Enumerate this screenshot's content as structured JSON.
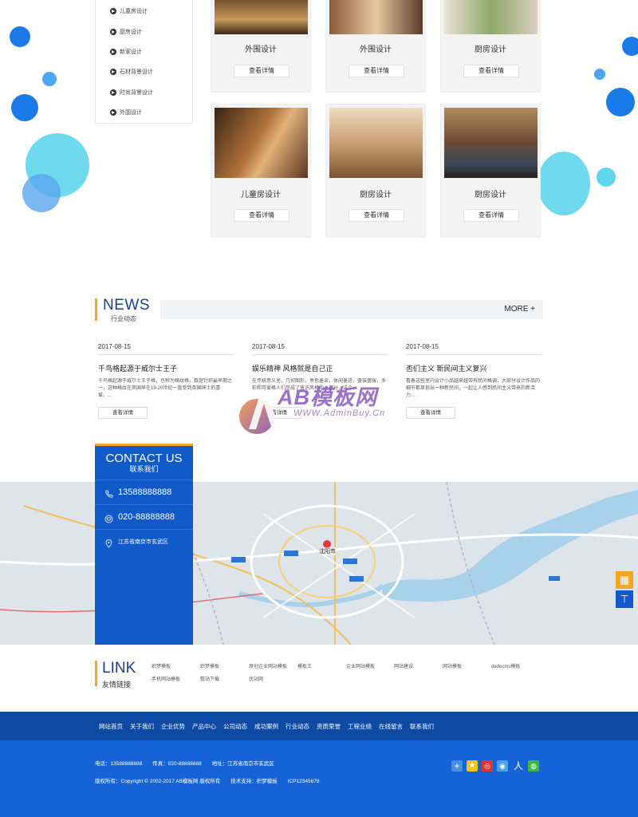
{
  "categories": [
    {
      "label": "儿童房设计"
    },
    {
      "label": "厨房设计"
    },
    {
      "label": "新家设计"
    },
    {
      "label": "石材背景设计"
    },
    {
      "label": "时尚背景设计"
    },
    {
      "label": "外围设计"
    }
  ],
  "products": [
    {
      "title": "外围设计",
      "button": "查看详情"
    },
    {
      "title": "外围设计",
      "button": "查看详情"
    },
    {
      "title": "厨房设计",
      "button": "查看详情"
    },
    {
      "title": "儿童房设计",
      "button": "查看详情"
    },
    {
      "title": "厨房设计",
      "button": "查看详情"
    },
    {
      "title": "厨房设计",
      "button": "查看详情"
    }
  ],
  "news": {
    "title": "NEWS",
    "subtitle": "行业动态",
    "more": "MORE +",
    "items": [
      {
        "date": "2017-08-15",
        "headline": "千鸟格起源于威尔士王子",
        "excerpt": "千鸟格起源于威尔士王子格，也称为格纹格，数是针织最早期之一，这种格纹在英国早在19-20世纪一直受到英国绅士的喜爱。...",
        "button": "查看详情"
      },
      {
        "date": "2017-08-15",
        "headline": "娱乐精神 风格就是自己正",
        "excerpt": "在传统意义里，几何图形，黑色墨染，休闲墨迹，盛装盛服，多彩和可爱格人们尽成了鉴识风格的一部分，这个…",
        "button": "查看详情"
      },
      {
        "date": "2017-08-15",
        "headline": "否们主义 新民间主义复兴",
        "excerpt": "看着这些室内设计小品越来越带有民间格调，大部分设计作品的细节都显现出一种新民间，一起让人感到民间主义带来的新活力…",
        "button": "查看详情"
      }
    ]
  },
  "watermark": {
    "brand": "AB模板网",
    "url": "WWW.AdminBuy.Cn"
  },
  "contact": {
    "title": "CONTACT US",
    "subtitle": "联系我们",
    "phone": "13588888888",
    "tel": "020-88888888",
    "address": "江苏省南京市玄武区"
  },
  "map": {
    "city_label": "沈阳市"
  },
  "links": {
    "title": "LINK",
    "subtitle": "友情链接",
    "items": [
      "织梦模板",
      "织梦模板",
      "原创企业网站模板",
      "模板王",
      "企业网站模板",
      "网站建设",
      "网站模板",
      "dedecms模板",
      "手机网站模板",
      "整站下载",
      "优站网"
    ]
  },
  "nav": [
    "网站首页",
    "关于我们",
    "企业优势",
    "产品中心",
    "公司动态",
    "成功案例",
    "行业动态",
    "资质荣誉",
    "工程业绩",
    "在线留言",
    "联系我们"
  ],
  "footer": {
    "contact_line": "电话：13588888888　　传真：020-88888888　　地址：江苏省南京市玄武区",
    "copyright_line": "版权所有：Copyright © 2002-2017 AB模板网 版权所有　　技术支持：织梦模板　　ICP12345678"
  },
  "colors": {
    "primary": "#1059c9",
    "accent": "#f5a623",
    "footer": "#1563d6",
    "nav": "#0c4aa3",
    "title_blue": "#1b3f8c"
  },
  "icons": [
    "phone-icon",
    "tel-icon",
    "location-icon",
    "qrcode-icon",
    "back-to-top-icon",
    "share-add-icon",
    "qzone-icon",
    "weibo-icon",
    "tencent-weibo-icon",
    "renren-icon",
    "wechat-icon"
  ]
}
